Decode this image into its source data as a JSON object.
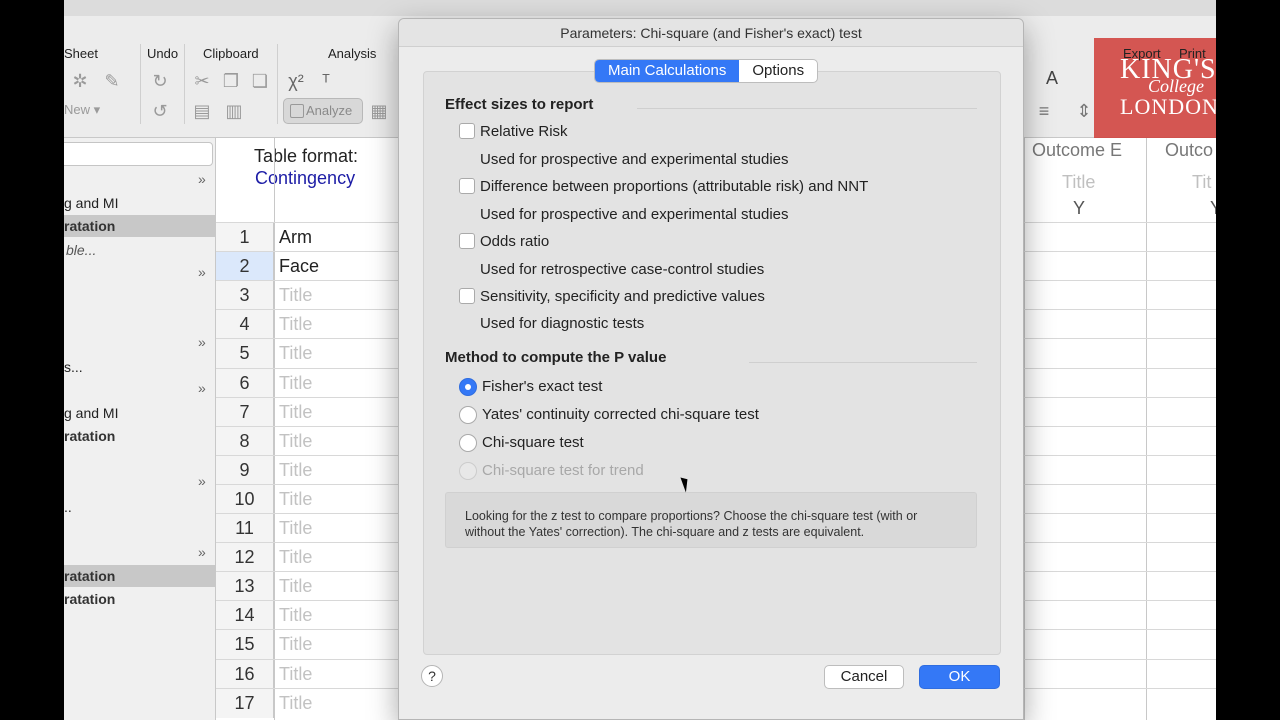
{
  "toolbar": {
    "groups": [
      "Sheet",
      "Undo",
      "Clipboard",
      "Analysis"
    ],
    "new_label": "New",
    "analyze_label": "Analyze",
    "export_label": "Export",
    "print_label": "Print"
  },
  "logo": {
    "line1": "KING'S",
    "line2": "College",
    "line3": "LONDON"
  },
  "sidebar": {
    "items": [
      "g and MI",
      "ratation",
      "ble...",
      "s...",
      "g and MI",
      "ratation",
      "..",
      "ratation",
      "ratation"
    ]
  },
  "sheet": {
    "format_label": "Table format:",
    "format_value": "Contingency",
    "rows": [
      {
        "n": "1",
        "title": "Arm"
      },
      {
        "n": "2",
        "title": "Face"
      },
      {
        "n": "3",
        "title": "Title"
      },
      {
        "n": "4",
        "title": "Title"
      },
      {
        "n": "5",
        "title": "Title"
      },
      {
        "n": "6",
        "title": "Title"
      },
      {
        "n": "7",
        "title": "Title"
      },
      {
        "n": "8",
        "title": "Title"
      },
      {
        "n": "9",
        "title": "Title"
      },
      {
        "n": "10",
        "title": "Title"
      },
      {
        "n": "11",
        "title": "Title"
      },
      {
        "n": "12",
        "title": "Title"
      },
      {
        "n": "13",
        "title": "Title"
      },
      {
        "n": "14",
        "title": "Title"
      },
      {
        "n": "15",
        "title": "Title"
      },
      {
        "n": "16",
        "title": "Title"
      },
      {
        "n": "17",
        "title": "Title"
      }
    ],
    "outcome_e": "Outcome E",
    "outcome_f": "Outco",
    "col_title": "Title",
    "col_title_f": "Tit",
    "col_y": "Y"
  },
  "dialog": {
    "title": "Parameters: Chi-square (and Fisher's exact) test",
    "tabs": [
      "Main Calculations",
      "Options"
    ],
    "effect_title": "Effect sizes to report",
    "effects": [
      {
        "label": "Relative Risk",
        "desc": "Used for prospective and experimental studies"
      },
      {
        "label": "Difference between proportions (attributable risk) and NNT",
        "desc": "Used for prospective and experimental studies"
      },
      {
        "label": "Odds ratio",
        "desc": "Used for retrospective case-control studies"
      },
      {
        "label": "Sensitivity, specificity and predictive values",
        "desc": "Used for diagnostic tests"
      }
    ],
    "method_title": "Method to compute the P value",
    "methods": [
      "Fisher's exact test",
      "Yates' continuity corrected chi-square test",
      "Chi-square test",
      "Chi-square test for trend"
    ],
    "selected_method": "Fisher's exact test",
    "note": "Looking for the z test to compare proportions? Choose the chi-square test (with or without the Yates' correction). The chi-square and z tests are equivalent.",
    "help": "?",
    "cancel": "Cancel",
    "ok": "OK"
  },
  "colors": {
    "accent": "#3478f6",
    "logo": "#d03c37",
    "format_value": "#1c1ca6"
  }
}
